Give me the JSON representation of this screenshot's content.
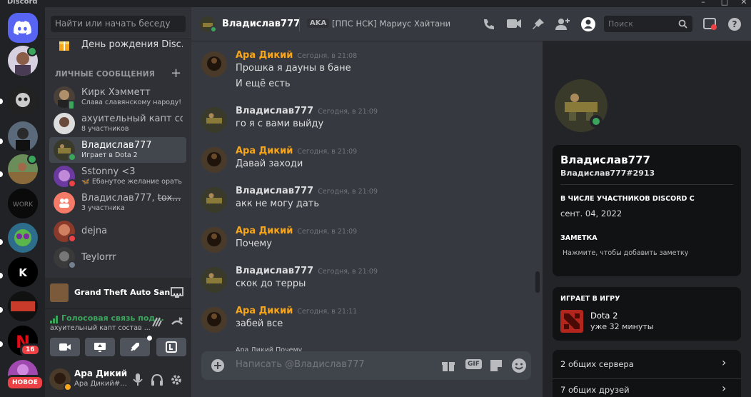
{
  "window": {
    "title": "Discord"
  },
  "rail": {
    "badge_count": "16",
    "new_label": "НОВОЕ"
  },
  "dm_sidebar": {
    "search_placeholder": "Найти или начать беседу",
    "birthday_label": "День рождения Disc...",
    "header": "ЛИЧНЫЕ СООБЩЕНИЯ",
    "items": [
      {
        "name": "Кирк Хэмметт",
        "sub": "Слава славянскому народу!",
        "status": "online-mobile"
      },
      {
        "name": "ахуительный капт со...",
        "sub": "8 участников",
        "status": "none"
      },
      {
        "name": "Владислав777",
        "sub": "Играет в Dota 2",
        "status": "online"
      },
      {
        "name": "Sstonny <3",
        "sub": "Ебанутое желание орать",
        "status": "dnd"
      },
      {
        "name": "Владислав777, ",
        "name_strike": "tox...",
        "sub": "3 участника",
        "status": "none"
      },
      {
        "name": "dejna",
        "sub": "",
        "status": "dnd"
      },
      {
        "name": "Teylorrr",
        "sub": "",
        "status": "offline"
      }
    ],
    "game_bar": {
      "title": "Grand Theft Auto San ..."
    },
    "voice": {
      "status": "Голосовая связь под...",
      "channel": "ахуительный капт состав ..."
    },
    "user": {
      "name": "Ара Дикий",
      "tag": "Ара Дикий#..."
    }
  },
  "topbar": {
    "channel_name": "Владислав777",
    "aka_label": "AKA",
    "aka_names": "[ППС НСК] Мариус Хайтани",
    "search_placeholder": "Поиск"
  },
  "messages": [
    {
      "author": "Ара Дикий",
      "time": "Сегодня, в 21:08",
      "lines": [
        "Прошка я дауны в бане",
        "И ещё есть"
      ],
      "color": "#faa61a"
    },
    {
      "author": "Владислав777",
      "time": "Сегодня, в 21:09",
      "lines": [
        "го я с вами выйду"
      ],
      "color": "#dcddde"
    },
    {
      "author": "Ара Дикий",
      "time": "Сегодня, в 21:09",
      "lines": [
        "Давай заходи"
      ],
      "color": "#faa61a"
    },
    {
      "author": "Владислав777",
      "time": "Сегодня, в 21:09",
      "lines": [
        "акк не могу дать"
      ],
      "color": "#dcddde"
    },
    {
      "author": "Ара Дикий",
      "time": "Сегодня, в 21:09",
      "lines": [
        "Почему"
      ],
      "color": "#faa61a"
    },
    {
      "author": "Владислав777",
      "time": "Сегодня, в 21:09",
      "lines": [
        "скок до терры"
      ],
      "color": "#dcddde"
    },
    {
      "author": "Ара Дикий",
      "time": "Сегодня, в 21:11",
      "lines": [
        "забей все"
      ],
      "color": "#faa61a"
    }
  ],
  "reply_preview": "Ара Дикий Почему",
  "composer": {
    "placeholder": "Написать @Владислав777",
    "gif_label": "GIF"
  },
  "profile": {
    "display_name": "Владислав777",
    "tag": "Владислав777#2913",
    "member_since_title": "В ЧИСЛЕ УЧАСТНИКОВ DISCORD С",
    "member_since": "сент. 04, 2022",
    "note_title": "ЗАМЕТКА",
    "note_placeholder": "Нажмите, чтобы добавить заметку",
    "playing_title": "ИГРАЕТ В ИГРУ",
    "game_name": "Dota 2",
    "game_elapsed": "уже 32 минуты",
    "mutual_servers": "2 общих сервера",
    "mutual_friends": "7 общих друзей"
  }
}
